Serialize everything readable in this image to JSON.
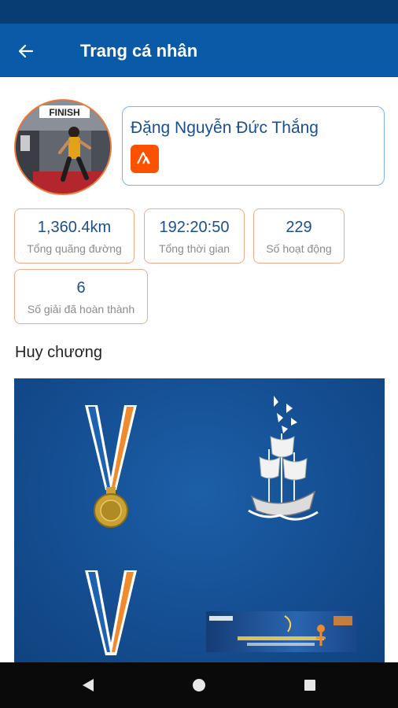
{
  "app_bar": {
    "title": "Trang cá nhân",
    "back_icon": "arrow-left-icon"
  },
  "profile": {
    "name": "Đặng Nguyễn Đức Thắng",
    "connected_app_icon": "strava-icon",
    "avatar_caption": "FINISH"
  },
  "stats": [
    {
      "value": "1,360.4km",
      "label": "Tổng quãng đường"
    },
    {
      "value": "192:20:50",
      "label": "Tổng thời gian"
    },
    {
      "value": "229",
      "label": "Số hoạt động"
    },
    {
      "value": "6",
      "label": "Số giải đã hoàn thành"
    }
  ],
  "medals": {
    "section_title": "Huy chương",
    "items": [
      {
        "icon": "medal-icon"
      },
      {
        "icon": "ship-artwork-icon"
      },
      {
        "icon": "medal-icon"
      },
      {
        "icon": "event-banner-image"
      }
    ]
  },
  "nav": {
    "back_icon": "triangle-back-icon",
    "home_icon": "circle-home-icon",
    "recents_icon": "square-recents-icon"
  },
  "colors": {
    "status_bar": "#073d72",
    "app_bar": "#0a5aa8",
    "accent_orange": "#f07a3a",
    "stat_value_blue": "#1b4f8e",
    "medal_panel": "#154e92",
    "strava_orange": "#fc5200"
  }
}
